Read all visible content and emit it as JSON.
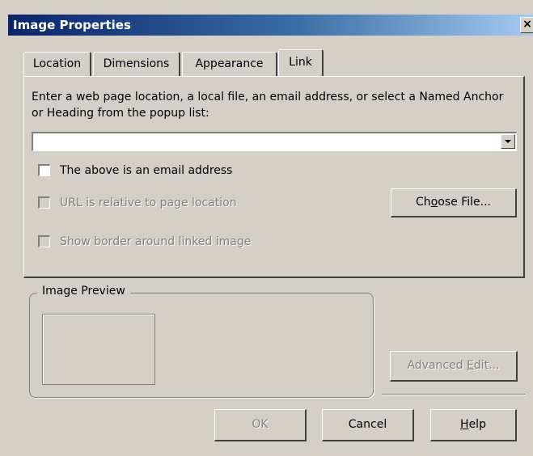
{
  "dialog": {
    "title": "Image Properties",
    "close_glyph": "×"
  },
  "tabs": [
    {
      "label": "Location",
      "active": false
    },
    {
      "label": "Dimensions",
      "active": false
    },
    {
      "label": "Appearance",
      "active": false
    },
    {
      "label": "Link",
      "active": true
    }
  ],
  "link": {
    "instructions": "Enter a web page location, a local file, an email address, or select a Named Anchor or Heading from the popup list:",
    "url_value": "",
    "email_checkbox_label": "The above is an email address",
    "email_checked": false,
    "relative_checkbox_label": "URL is relative to page location",
    "relative_checked": false,
    "border_checkbox_label": "Show border around linked image",
    "border_checked": false,
    "choose_file_pre": "Ch",
    "choose_file_mnemonic": "o",
    "choose_file_post": "ose File..."
  },
  "preview": {
    "legend": "Image Preview"
  },
  "buttons": {
    "advanced_pre": "Advanced ",
    "advanced_mnemonic": "E",
    "advanced_post": "dit...",
    "ok": "OK",
    "cancel": "Cancel",
    "help_mnemonic": "H",
    "help_post": "elp"
  }
}
